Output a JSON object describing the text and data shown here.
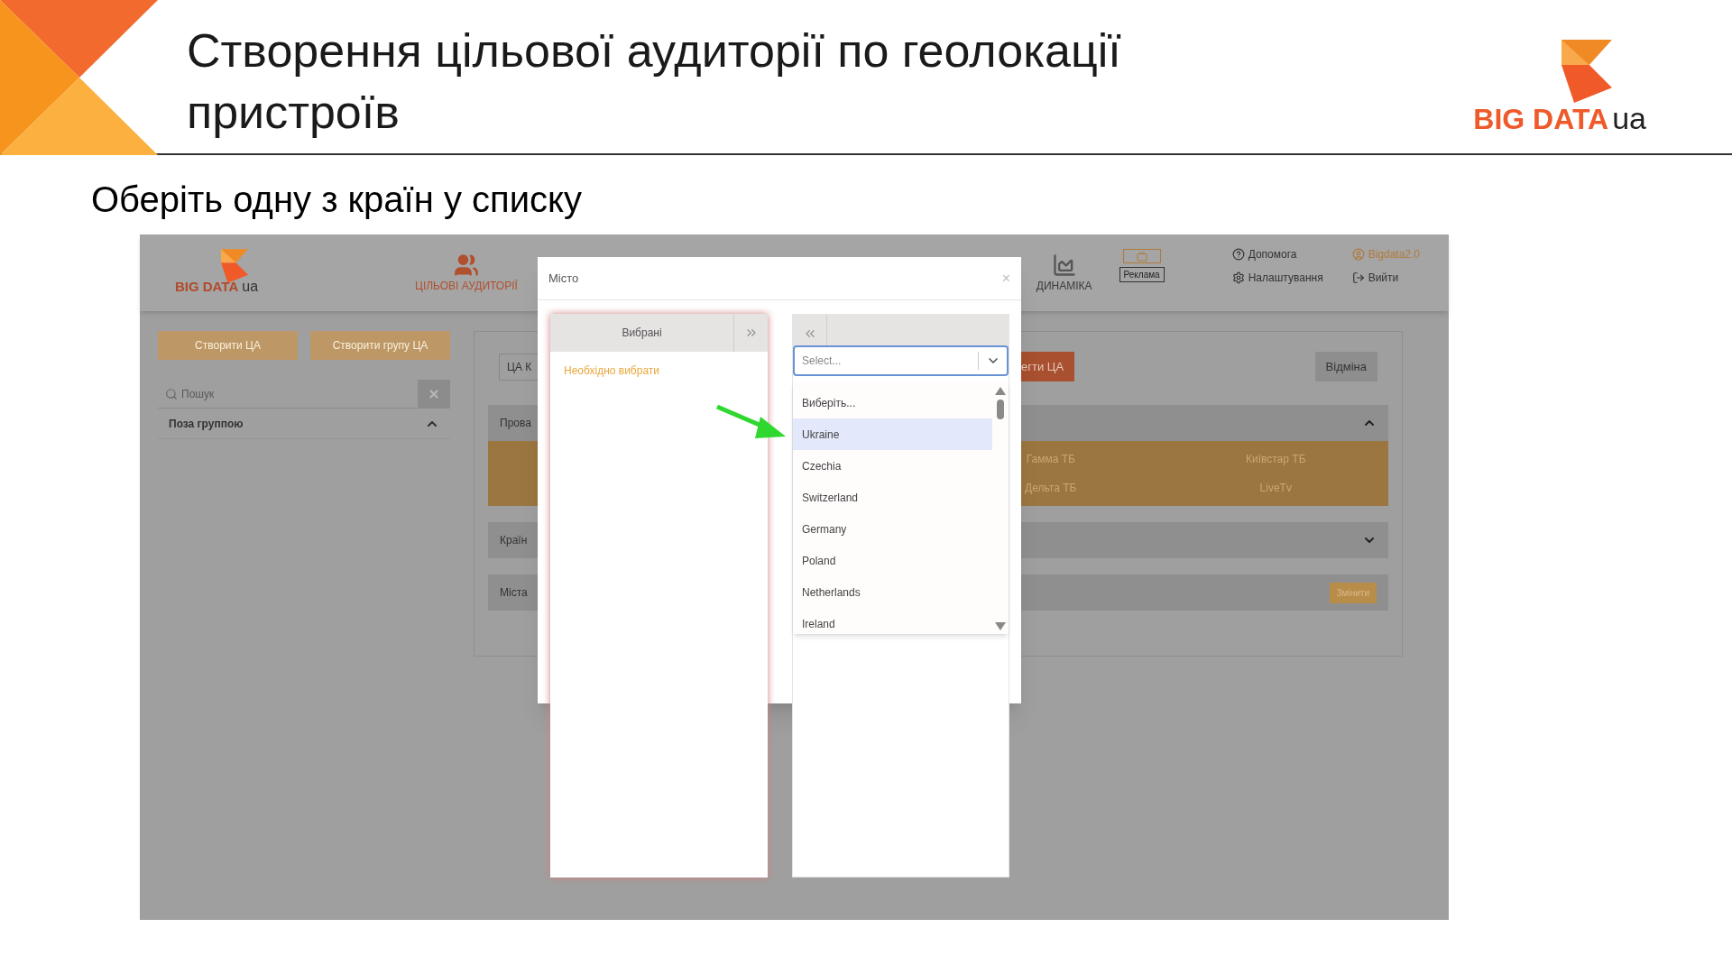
{
  "slide": {
    "title": "Створення цільової аудиторії по геолокації пристроїв",
    "subtitle": "Оберіть одну з країн у списку",
    "logo": {
      "brand": "BIG DATA",
      "suffix": "ua"
    }
  },
  "app": {
    "logo": {
      "brand": "BIG DATA",
      "suffix": "ua"
    },
    "nav": [
      {
        "kind": "audiences",
        "label": "ЦІЛЬОВІ АУДИТОРІЇ",
        "selected": true
      },
      {
        "kind": "dynamics",
        "label": "ДИНАМІКА",
        "selected": false
      }
    ],
    "ad_badge": "Реклама",
    "links": [
      {
        "kind": "help",
        "label": "Допомога"
      },
      {
        "kind": "settings",
        "label": "Налаштування"
      },
      {
        "kind": "user",
        "label": "Bigdata2.0"
      },
      {
        "kind": "logout",
        "label": "Вийти"
      }
    ],
    "sidebar": {
      "buttons": [
        "Створити ЦА",
        "Створити групу ЦА"
      ],
      "search": {
        "placeholder": "Пошук"
      },
      "group": {
        "label": "Поза группою",
        "expanded": true
      }
    },
    "main": {
      "name_field": "ЦА К",
      "save_button": "егти ЦА",
      "cancel_button": "Відміна",
      "sections": [
        {
          "label": "Прова",
          "expanded": true,
          "rows": [
            {
              "cells": [
                "Гамма ТБ",
                "Київстар ТБ"
              ]
            },
            {
              "cells": [
                "Дельта ТБ",
                "LiveTv"
              ]
            }
          ]
        },
        {
          "label": "Країн",
          "expanded": false
        },
        {
          "label": "Міста",
          "action": "Змінити"
        }
      ]
    },
    "modal": {
      "title": "Місто",
      "close": "×",
      "selected_panel": {
        "title": "Вибрані",
        "empty_text": "Необхідно вибрати"
      },
      "select": {
        "placeholder": "Select...",
        "options": [
          {
            "label": "Виберіть...",
            "selected": false
          },
          {
            "label": "Ukraine",
            "selected": true
          },
          {
            "label": "Czechia",
            "selected": false
          },
          {
            "label": "Switzerland",
            "selected": false
          },
          {
            "label": "Germany",
            "selected": false
          },
          {
            "label": "Poland",
            "selected": false
          },
          {
            "label": "Netherlands",
            "selected": false
          },
          {
            "label": "Ireland",
            "selected": false
          }
        ]
      }
    }
  }
}
